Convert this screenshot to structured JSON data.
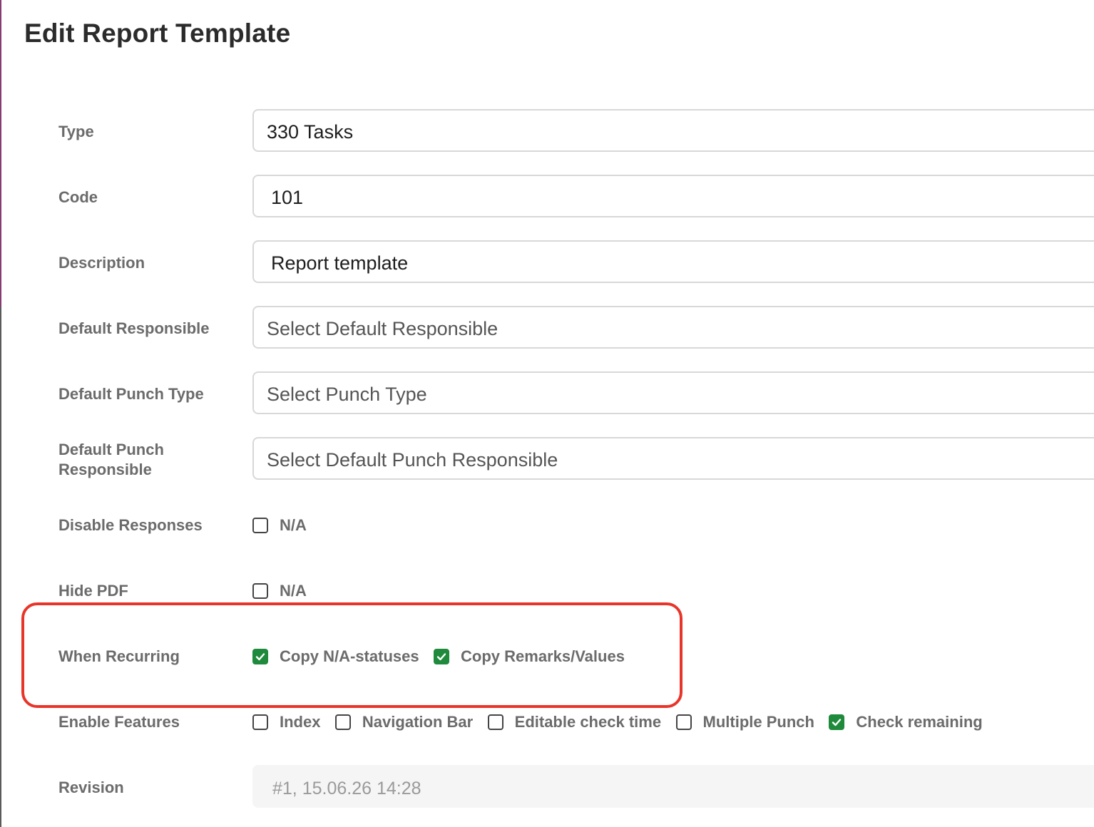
{
  "page": {
    "title": "Edit Report Template"
  },
  "form": {
    "type": {
      "label": "Type",
      "value": "330 Tasks"
    },
    "code": {
      "label": "Code",
      "value": "101"
    },
    "description": {
      "label": "Description",
      "value": "Report template"
    },
    "default_responsible": {
      "label": "Default Responsible",
      "placeholder": "Select Default Responsible"
    },
    "default_punch_type": {
      "label": "Default Punch Type",
      "placeholder": "Select Punch Type"
    },
    "default_punch_responsible": {
      "label_line1": "Default Punch",
      "label_line2": "Responsible",
      "placeholder": "Select Default Punch Responsible"
    },
    "disable_responses": {
      "label": "Disable Responses",
      "options": [
        {
          "label": "N/A",
          "checked": false
        }
      ]
    },
    "hide_pdf": {
      "label": "Hide PDF",
      "options": [
        {
          "label": "N/A",
          "checked": false
        }
      ]
    },
    "when_recurring": {
      "label": "When Recurring",
      "options": [
        {
          "label": "Copy N/A-statuses",
          "checked": true
        },
        {
          "label": "Copy Remarks/Values",
          "checked": true
        }
      ]
    },
    "enable_features": {
      "label": "Enable Features",
      "options": [
        {
          "label": "Index",
          "checked": false
        },
        {
          "label": "Navigation Bar",
          "checked": false
        },
        {
          "label": "Editable check time",
          "checked": false
        },
        {
          "label": "Multiple Punch",
          "checked": false
        },
        {
          "label": "Check remaining",
          "checked": true
        }
      ]
    },
    "revision": {
      "label": "Revision",
      "value": "#1, 15.06.26 14:28"
    }
  },
  "colors": {
    "checked": "#1f8a3c",
    "highlight": "#e8352a",
    "label": "#6b6b6b"
  },
  "icons": {
    "check": "checkmark-icon"
  }
}
